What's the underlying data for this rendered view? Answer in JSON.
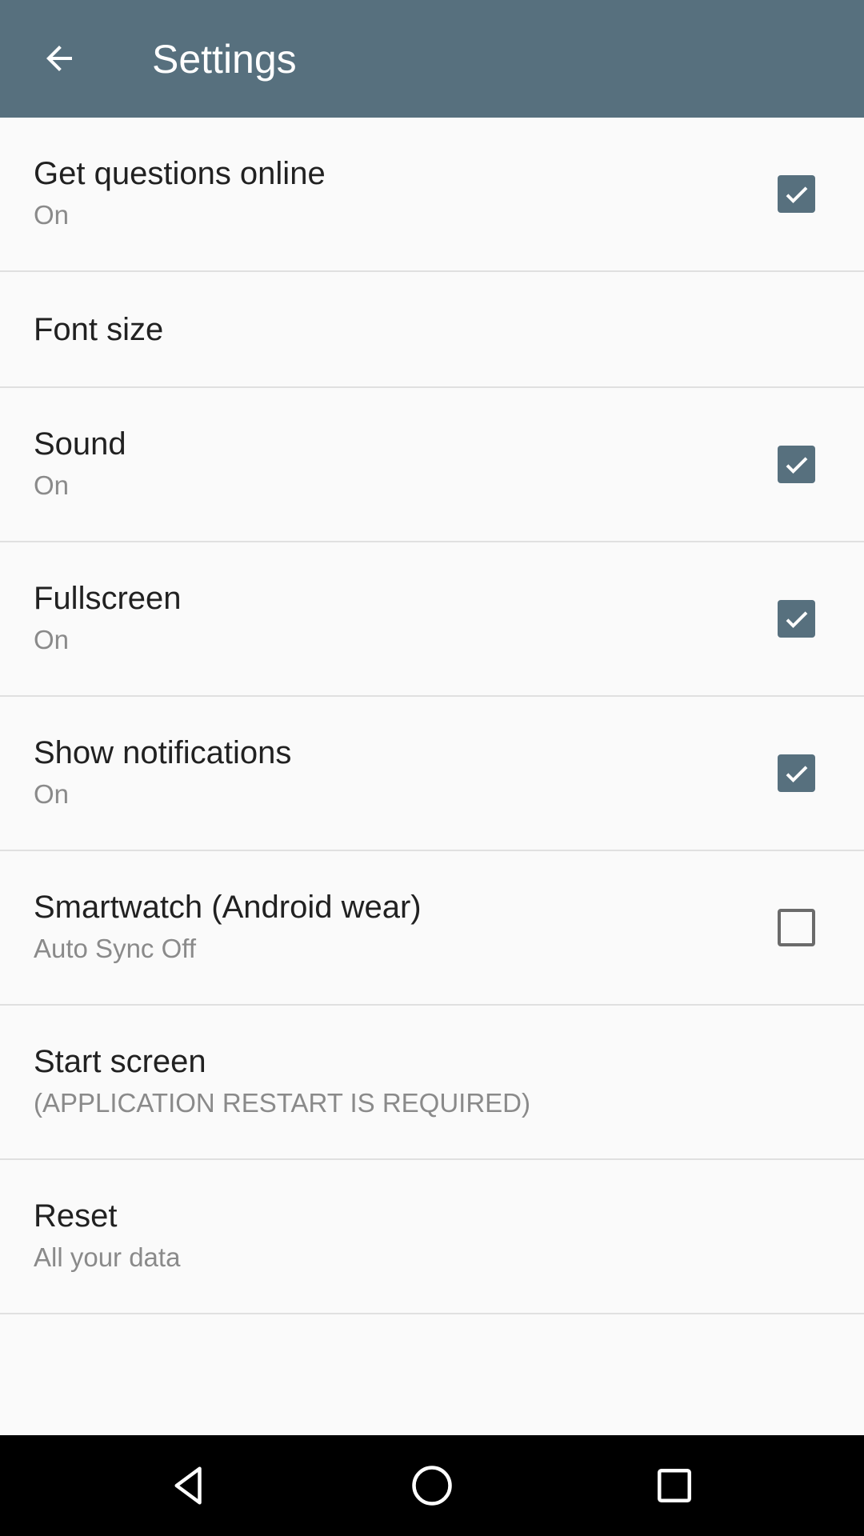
{
  "toolbar": {
    "title": "Settings",
    "back_icon": "arrow-back-icon"
  },
  "settings": [
    {
      "title": "Get questions online",
      "summary": "On",
      "checkbox": true
    },
    {
      "title": "Font size",
      "summary": "",
      "checkbox": null
    },
    {
      "title": "Sound",
      "summary": "On",
      "checkbox": true
    },
    {
      "title": "Fullscreen",
      "summary": "On",
      "checkbox": true
    },
    {
      "title": "Show notifications",
      "summary": "On",
      "checkbox": true
    },
    {
      "title": "Smartwatch (Android wear)",
      "summary": "Auto Sync Off",
      "checkbox": false
    },
    {
      "title": "Start screen",
      "summary": "(APPLICATION RESTART IS REQUIRED)",
      "checkbox": null
    },
    {
      "title": "Reset",
      "summary": "All your data",
      "checkbox": null
    }
  ],
  "colors": {
    "toolbar": "#57707e",
    "checkbox_checked": "#57707e",
    "background": "#fafafa"
  },
  "navbar": {
    "back_icon": "nav-back-icon",
    "home_icon": "nav-home-icon",
    "recents_icon": "nav-recents-icon"
  }
}
